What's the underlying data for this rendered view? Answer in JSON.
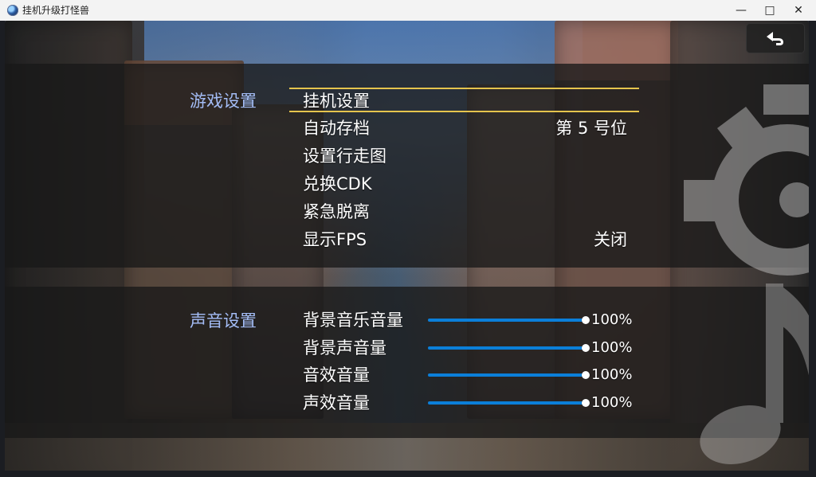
{
  "window": {
    "title": "挂机升级打怪兽",
    "controls": {
      "minimize": "—",
      "maximize": "□",
      "close": "✕"
    }
  },
  "icons": {
    "app": "game-app-icon",
    "back": "back-arrow-icon",
    "gear": "gear-icon",
    "music": "music-note-icon"
  },
  "colors": {
    "accent": "#e5c44d",
    "section_label": "#a4bdf6",
    "slider": "#0b7fd9",
    "panel": "#181818"
  },
  "game_settings": {
    "label": "游戏设置",
    "items": [
      {
        "label": "挂机设置",
        "value": "",
        "selected": true
      },
      {
        "label": "自动存档",
        "value": "第 5 号位",
        "selected": false
      },
      {
        "label": "设置行走图",
        "value": "",
        "selected": false
      },
      {
        "label": "兑换CDK",
        "value": "",
        "selected": false
      },
      {
        "label": "紧急脱离",
        "value": "",
        "selected": false
      },
      {
        "label": "显示FPS",
        "value": "关闭",
        "selected": false
      }
    ]
  },
  "sound_settings": {
    "label": "声音设置",
    "items": [
      {
        "label": "背景音乐音量",
        "value": "100%",
        "level": 1.0
      },
      {
        "label": "背景声音量",
        "value": "100%",
        "level": 1.0
      },
      {
        "label": "音效音量",
        "value": "100%",
        "level": 1.0
      },
      {
        "label": "声效音量",
        "value": "100%",
        "level": 1.0
      }
    ]
  }
}
